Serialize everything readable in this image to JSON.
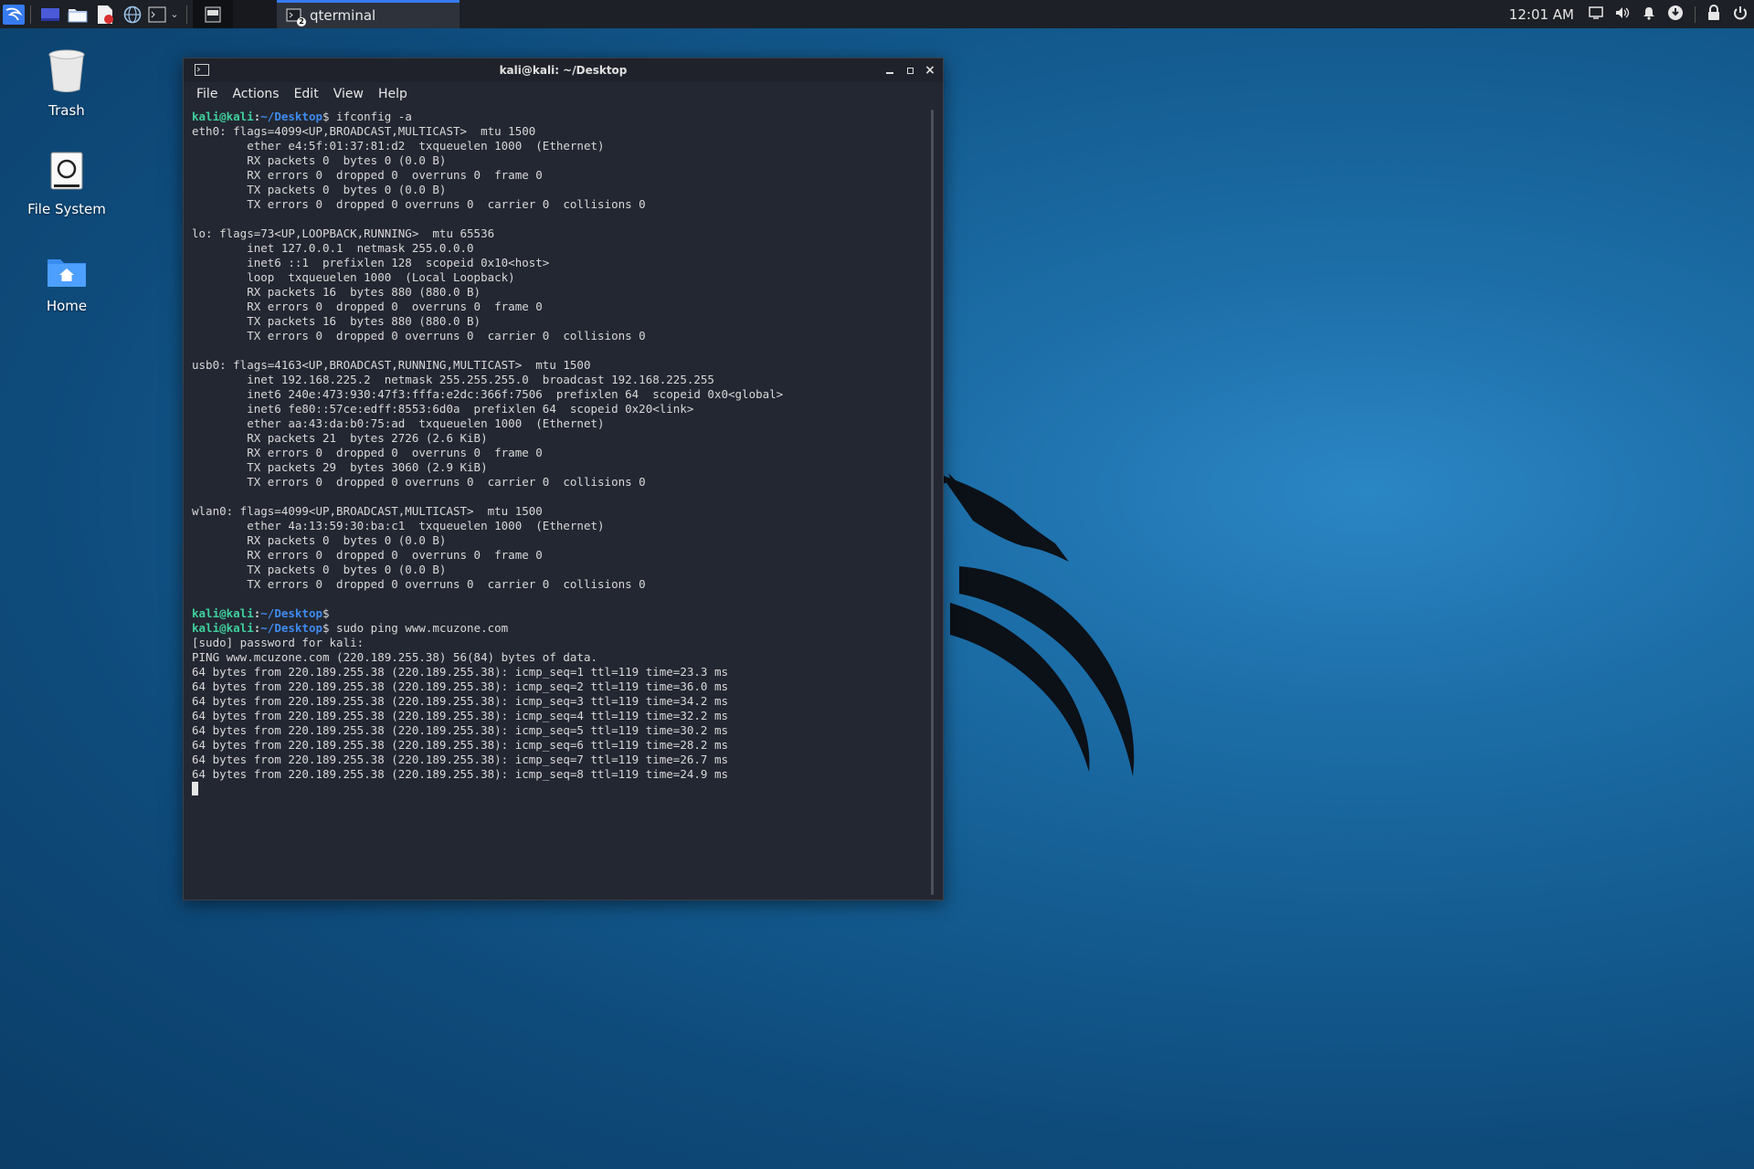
{
  "panel": {
    "task_label": "qterminal",
    "task_badge": "2",
    "clock": "12:01 AM"
  },
  "desktop": {
    "icons": [
      {
        "label": "Trash",
        "icon": "trash-icon"
      },
      {
        "label": "File System",
        "icon": "drive-icon"
      },
      {
        "label": "Home",
        "icon": "home-folder-icon"
      }
    ]
  },
  "terminal": {
    "title": "kali@kali: ~/Desktop",
    "menu": [
      "File",
      "Actions",
      "Edit",
      "View",
      "Help"
    ],
    "prompt": {
      "user": "kali@kali",
      "colon": ":",
      "path": "~/Desktop",
      "dollar": "$"
    },
    "lines": [
      {
        "prompt": true,
        "text": " ifconfig -a"
      },
      {
        "text": "eth0: flags=4099<UP,BROADCAST,MULTICAST>  mtu 1500"
      },
      {
        "text": "        ether e4:5f:01:37:81:d2  txqueuelen 1000  (Ethernet)"
      },
      {
        "text": "        RX packets 0  bytes 0 (0.0 B)"
      },
      {
        "text": "        RX errors 0  dropped 0  overruns 0  frame 0"
      },
      {
        "text": "        TX packets 0  bytes 0 (0.0 B)"
      },
      {
        "text": "        TX errors 0  dropped 0 overruns 0  carrier 0  collisions 0"
      },
      {
        "text": ""
      },
      {
        "text": "lo: flags=73<UP,LOOPBACK,RUNNING>  mtu 65536"
      },
      {
        "text": "        inet 127.0.0.1  netmask 255.0.0.0"
      },
      {
        "text": "        inet6 ::1  prefixlen 128  scopeid 0x10<host>"
      },
      {
        "text": "        loop  txqueuelen 1000  (Local Loopback)"
      },
      {
        "text": "        RX packets 16  bytes 880 (880.0 B)"
      },
      {
        "text": "        RX errors 0  dropped 0  overruns 0  frame 0"
      },
      {
        "text": "        TX packets 16  bytes 880 (880.0 B)"
      },
      {
        "text": "        TX errors 0  dropped 0 overruns 0  carrier 0  collisions 0"
      },
      {
        "text": ""
      },
      {
        "text": "usb0: flags=4163<UP,BROADCAST,RUNNING,MULTICAST>  mtu 1500"
      },
      {
        "text": "        inet 192.168.225.2  netmask 255.255.255.0  broadcast 192.168.225.255"
      },
      {
        "text": "        inet6 240e:473:930:47f3:fffa:e2dc:366f:7506  prefixlen 64  scopeid 0x0<global>"
      },
      {
        "text": "        inet6 fe80::57ce:edff:8553:6d0a  prefixlen 64  scopeid 0x20<link>"
      },
      {
        "text": "        ether aa:43:da:b0:75:ad  txqueuelen 1000  (Ethernet)"
      },
      {
        "text": "        RX packets 21  bytes 2726 (2.6 KiB)"
      },
      {
        "text": "        RX errors 0  dropped 0  overruns 0  frame 0"
      },
      {
        "text": "        TX packets 29  bytes 3060 (2.9 KiB)"
      },
      {
        "text": "        TX errors 0  dropped 0 overruns 0  carrier 0  collisions 0"
      },
      {
        "text": ""
      },
      {
        "text": "wlan0: flags=4099<UP,BROADCAST,MULTICAST>  mtu 1500"
      },
      {
        "text": "        ether 4a:13:59:30:ba:c1  txqueuelen 1000  (Ethernet)"
      },
      {
        "text": "        RX packets 0  bytes 0 (0.0 B)"
      },
      {
        "text": "        RX errors 0  dropped 0  overruns 0  frame 0"
      },
      {
        "text": "        TX packets 0  bytes 0 (0.0 B)"
      },
      {
        "text": "        TX errors 0  dropped 0 overruns 0  carrier 0  collisions 0"
      },
      {
        "text": ""
      },
      {
        "prompt": true,
        "text": ""
      },
      {
        "prompt": true,
        "text": " sudo ping www.mcuzone.com"
      },
      {
        "text": "[sudo] password for kali:"
      },
      {
        "text": "PING www.mcuzone.com (220.189.255.38) 56(84) bytes of data."
      },
      {
        "text": "64 bytes from 220.189.255.38 (220.189.255.38): icmp_seq=1 ttl=119 time=23.3 ms"
      },
      {
        "text": "64 bytes from 220.189.255.38 (220.189.255.38): icmp_seq=2 ttl=119 time=36.0 ms"
      },
      {
        "text": "64 bytes from 220.189.255.38 (220.189.255.38): icmp_seq=3 ttl=119 time=34.2 ms"
      },
      {
        "text": "64 bytes from 220.189.255.38 (220.189.255.38): icmp_seq=4 ttl=119 time=32.2 ms"
      },
      {
        "text": "64 bytes from 220.189.255.38 (220.189.255.38): icmp_seq=5 ttl=119 time=30.2 ms"
      },
      {
        "text": "64 bytes from 220.189.255.38 (220.189.255.38): icmp_seq=6 ttl=119 time=28.2 ms"
      },
      {
        "text": "64 bytes from 220.189.255.38 (220.189.255.38): icmp_seq=7 ttl=119 time=26.7 ms"
      },
      {
        "text": "64 bytes from 220.189.255.38 (220.189.255.38): icmp_seq=8 ttl=119 time=24.9 ms"
      }
    ]
  },
  "colors": {
    "prompt_user": "#3fcf9d",
    "prompt_path": "#3e8bf0",
    "terminal_bg": "#232731",
    "panel_bg": "#1d2026",
    "accent": "#367bf0"
  }
}
